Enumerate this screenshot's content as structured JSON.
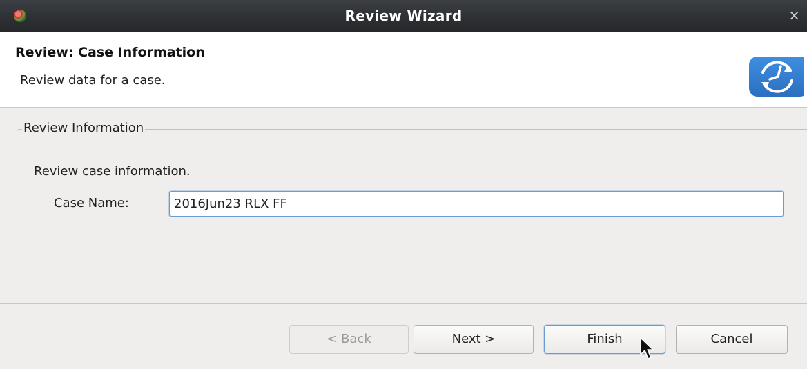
{
  "window": {
    "title": "Review Wizard",
    "close_glyph": "×"
  },
  "header": {
    "title": "Review: Case Information",
    "description": "Review data for a case."
  },
  "group": {
    "legend": "Review Information",
    "description": "Review case information.",
    "case_name_label": "Case Name:",
    "case_name_value": "2016Jun23 RLX FF"
  },
  "buttons": {
    "back": "< Back",
    "next": "Next >",
    "finish": "Finish",
    "cancel": "Cancel"
  },
  "icons": {
    "app": "app-icon",
    "close": "close-icon",
    "wizard": "review-clock-logo-icon",
    "cursor": "mouse-pointer-icon"
  },
  "colors": {
    "titlebar": "#2e3134",
    "header_bg": "#ffffff",
    "dialog_bg": "#efeeec",
    "focus_accent": "#6b9bd3",
    "logo_blue": "#3a80d6"
  }
}
